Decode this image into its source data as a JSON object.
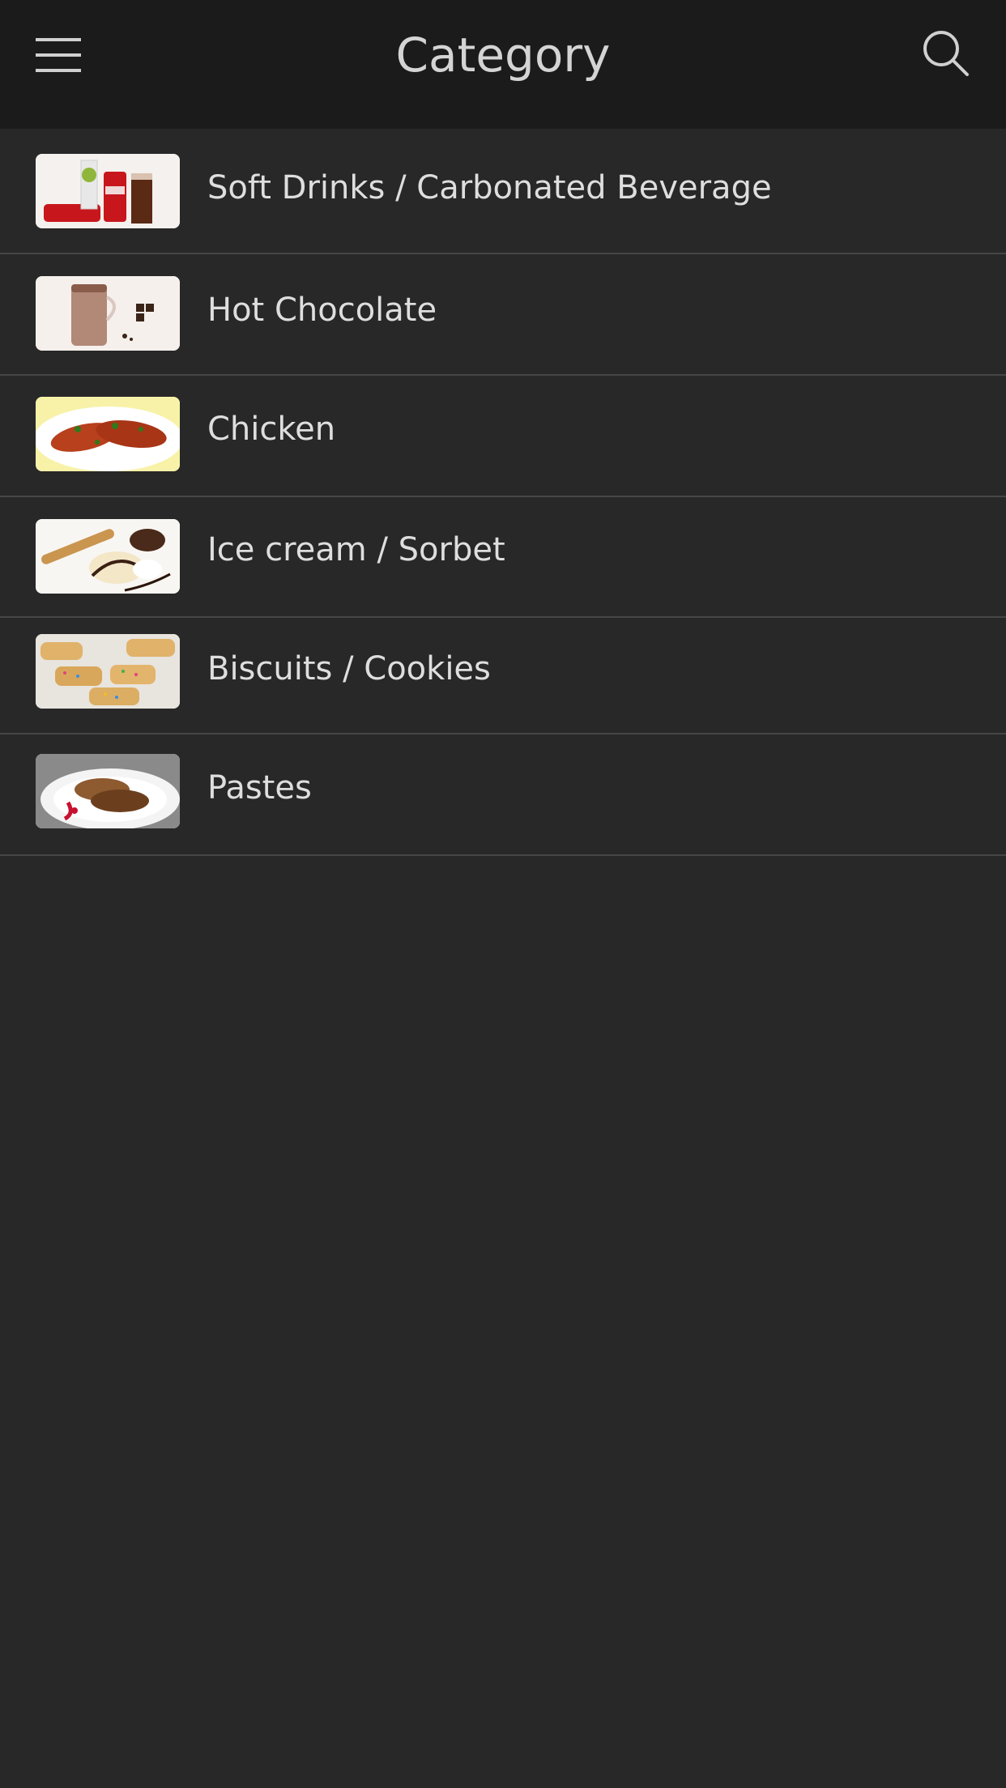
{
  "header": {
    "title": "Category",
    "menu_icon": "hamburger-menu-icon",
    "search_icon": "search-icon"
  },
  "categories": [
    {
      "label": "Soft Drinks / Carbonated Beverage",
      "thumbnail": "soft-drinks-thumbnail"
    },
    {
      "label": "Hot Chocolate",
      "thumbnail": "hot-chocolate-thumbnail"
    },
    {
      "label": "Chicken",
      "thumbnail": "chicken-thumbnail"
    },
    {
      "label": "Ice cream / Sorbet",
      "thumbnail": "ice-cream-thumbnail"
    },
    {
      "label": "Biscuits / Cookies",
      "thumbnail": "biscuits-thumbnail"
    },
    {
      "label": "Pastes",
      "thumbnail": "pastes-thumbnail"
    }
  ],
  "colors": {
    "topbar_bg": "#1b1b1b",
    "page_bg": "#282828",
    "divider": "#464646",
    "text": "#dedede"
  }
}
